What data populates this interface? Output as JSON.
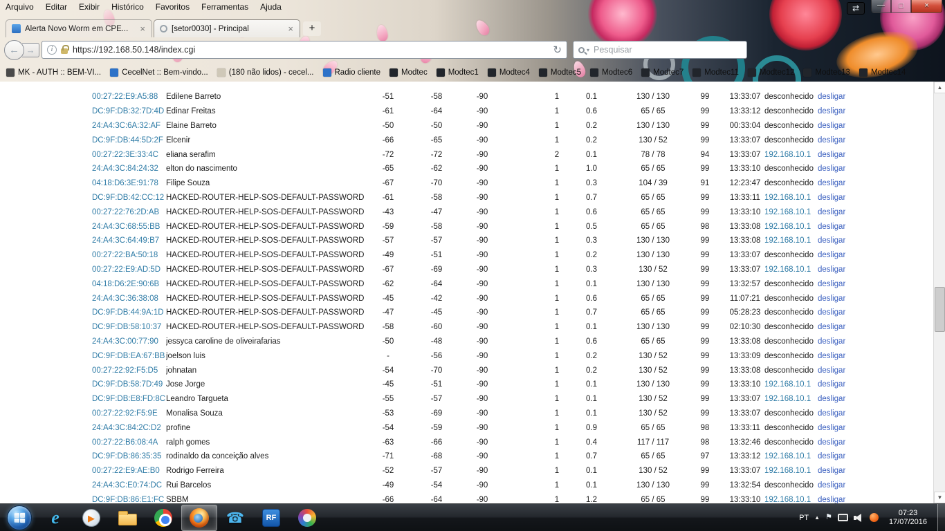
{
  "colors": {
    "mac_link": "#2e7ba6",
    "action_link": "#3a5fbf"
  },
  "browser": {
    "menu": [
      "Arquivo",
      "Editar",
      "Exibir",
      "Histórico",
      "Favoritos",
      "Ferramentas",
      "Ajuda"
    ],
    "window_controls": {
      "fullscreen": "⇄",
      "minimize": "—",
      "maximize": "□",
      "close": "×"
    },
    "tabs": [
      {
        "title": "Alerta Novo Worm em CPE...",
        "close": "×"
      },
      {
        "title": "[setor0030] - Principal",
        "close": "×"
      }
    ],
    "new_tab": "+",
    "nav": {
      "back": "←",
      "forward": "→",
      "url": "https://192.168.50.148/index.cgi",
      "reload": "↻",
      "identity": "i",
      "search_placeholder": "Pesquisar"
    },
    "bookmarks": [
      {
        "label": "MK - AUTH :: BEM-VI...",
        "icon_color": "#4a4a4a"
      },
      {
        "label": "CecelNet :: Bem-vindo...",
        "icon_color": "#2d72c8"
      },
      {
        "label": "(180 não lidos) - cecel...",
        "icon_color": "#cfc8b8"
      },
      {
        "label": "Radio cliente",
        "icon_color": "#2d72c8"
      },
      {
        "label": "Modtec",
        "icon_color": "#21252b"
      },
      {
        "label": "Modtec1",
        "icon_color": "#21252b"
      },
      {
        "label": "Modtec4",
        "icon_color": "#21252b"
      },
      {
        "label": "Modtec5",
        "icon_color": "#21252b"
      },
      {
        "label": "Modtec6",
        "icon_color": "#21252b"
      },
      {
        "label": "Modtec7",
        "icon_color": "#21252b"
      },
      {
        "label": "Modtec11",
        "icon_color": "#21252b"
      },
      {
        "label": "Modtec12",
        "icon_color": "#21252b"
      },
      {
        "label": "Modtec13",
        "icon_color": "#21252b"
      },
      {
        "label": "Modtec14",
        "icon_color": "#21252b"
      }
    ]
  },
  "page": {
    "unknown_ip_label": "desconhecido",
    "rows": [
      {
        "mac": "00:27:22:E9:A5:88",
        "name": "Edilene Barreto",
        "s1": "-51",
        "s2": "-58",
        "noise": "-90",
        "n": "1",
        "rate": "0.1",
        "speed": "130 / 130",
        "ccq": "99",
        "time": "13:33:07",
        "ip": "desconhecido",
        "action": "desligar"
      },
      {
        "mac": "DC:9F:DB:32:7D:4D",
        "name": "Edinar Freitas",
        "s1": "-61",
        "s2": "-64",
        "noise": "-90",
        "n": "1",
        "rate": "0.6",
        "speed": "65 / 65",
        "ccq": "99",
        "time": "13:33:12",
        "ip": "desconhecido",
        "action": "desligar"
      },
      {
        "mac": "24:A4:3C:6A:32:AF",
        "name": "Elaine Barreto",
        "s1": "-50",
        "s2": "-50",
        "noise": "-90",
        "n": "1",
        "rate": "0.2",
        "speed": "130 / 130",
        "ccq": "99",
        "time": "00:33:04",
        "ip": "desconhecido",
        "action": "desligar"
      },
      {
        "mac": "DC:9F:DB:44:5D:2F",
        "name": "Elcenir",
        "s1": "-66",
        "s2": "-65",
        "noise": "-90",
        "n": "1",
        "rate": "0.2",
        "speed": "130 / 52",
        "ccq": "99",
        "time": "13:33:07",
        "ip": "desconhecido",
        "action": "desligar"
      },
      {
        "mac": "00:27:22:3E:33:4C",
        "name": "eliana serafim",
        "s1": "-72",
        "s2": "-72",
        "noise": "-90",
        "n": "2",
        "rate": "0.1",
        "speed": "78 / 78",
        "ccq": "94",
        "time": "13:33:07",
        "ip": "192.168.10.1",
        "action": "desligar"
      },
      {
        "mac": "24:A4:3C:84:24:32",
        "name": "elton do nascimento",
        "s1": "-65",
        "s2": "-62",
        "noise": "-90",
        "n": "1",
        "rate": "1.0",
        "speed": "65 / 65",
        "ccq": "99",
        "time": "13:33:10",
        "ip": "desconhecido",
        "action": "desligar"
      },
      {
        "mac": "04:18:D6:3E:91:78",
        "name": "Filipe Souza",
        "s1": "-67",
        "s2": "-70",
        "noise": "-90",
        "n": "1",
        "rate": "0.3",
        "speed": "104 / 39",
        "ccq": "91",
        "time": "12:23:47",
        "ip": "desconhecido",
        "action": "desligar"
      },
      {
        "mac": "DC:9F:DB:42:CC:12",
        "name": "HACKED-ROUTER-HELP-SOS-DEFAULT-PASSWORD",
        "s1": "-61",
        "s2": "-58",
        "noise": "-90",
        "n": "1",
        "rate": "0.7",
        "speed": "65 / 65",
        "ccq": "99",
        "time": "13:33:11",
        "ip": "192.168.10.1",
        "action": "desligar"
      },
      {
        "mac": "00:27:22:76:2D:AB",
        "name": "HACKED-ROUTER-HELP-SOS-DEFAULT-PASSWORD",
        "s1": "-43",
        "s2": "-47",
        "noise": "-90",
        "n": "1",
        "rate": "0.6",
        "speed": "65 / 65",
        "ccq": "99",
        "time": "13:33:10",
        "ip": "192.168.10.1",
        "action": "desligar"
      },
      {
        "mac": "24:A4:3C:68:55:BB",
        "name": "HACKED-ROUTER-HELP-SOS-DEFAULT-PASSWORD",
        "s1": "-59",
        "s2": "-58",
        "noise": "-90",
        "n": "1",
        "rate": "0.5",
        "speed": "65 / 65",
        "ccq": "98",
        "time": "13:33:08",
        "ip": "192.168.10.1",
        "action": "desligar"
      },
      {
        "mac": "24:A4:3C:64:49:B7",
        "name": "HACKED-ROUTER-HELP-SOS-DEFAULT-PASSWORD",
        "s1": "-57",
        "s2": "-57",
        "noise": "-90",
        "n": "1",
        "rate": "0.3",
        "speed": "130 / 130",
        "ccq": "99",
        "time": "13:33:08",
        "ip": "192.168.10.1",
        "action": "desligar"
      },
      {
        "mac": "00:27:22:BA:50:18",
        "name": "HACKED-ROUTER-HELP-SOS-DEFAULT-PASSWORD",
        "s1": "-49",
        "s2": "-51",
        "noise": "-90",
        "n": "1",
        "rate": "0.2",
        "speed": "130 / 130",
        "ccq": "99",
        "time": "13:33:07",
        "ip": "desconhecido",
        "action": "desligar"
      },
      {
        "mac": "00:27:22:E9:AD:5D",
        "name": "HACKED-ROUTER-HELP-SOS-DEFAULT-PASSWORD",
        "s1": "-67",
        "s2": "-69",
        "noise": "-90",
        "n": "1",
        "rate": "0.3",
        "speed": "130 / 52",
        "ccq": "99",
        "time": "13:33:07",
        "ip": "192.168.10.1",
        "action": "desligar"
      },
      {
        "mac": "04:18:D6:2E:90:6B",
        "name": "HACKED-ROUTER-HELP-SOS-DEFAULT-PASSWORD",
        "s1": "-62",
        "s2": "-64",
        "noise": "-90",
        "n": "1",
        "rate": "0.1",
        "speed": "130 / 130",
        "ccq": "99",
        "time": "13:32:57",
        "ip": "desconhecido",
        "action": "desligar"
      },
      {
        "mac": "24:A4:3C:36:38:08",
        "name": "HACKED-ROUTER-HELP-SOS-DEFAULT-PASSWORD",
        "s1": "-45",
        "s2": "-42",
        "noise": "-90",
        "n": "1",
        "rate": "0.6",
        "speed": "65 / 65",
        "ccq": "99",
        "time": "11:07:21",
        "ip": "desconhecido",
        "action": "desligar"
      },
      {
        "mac": "DC:9F:DB:44:9A:1D",
        "name": "HACKED-ROUTER-HELP-SOS-DEFAULT-PASSWORD",
        "s1": "-47",
        "s2": "-45",
        "noise": "-90",
        "n": "1",
        "rate": "0.7",
        "speed": "65 / 65",
        "ccq": "99",
        "time": "05:28:23",
        "ip": "desconhecido",
        "action": "desligar"
      },
      {
        "mac": "DC:9F:DB:58:10:37",
        "name": "HACKED-ROUTER-HELP-SOS-DEFAULT-PASSWORD",
        "s1": "-58",
        "s2": "-60",
        "noise": "-90",
        "n": "1",
        "rate": "0.1",
        "speed": "130 / 130",
        "ccq": "99",
        "time": "02:10:30",
        "ip": "desconhecido",
        "action": "desligar"
      },
      {
        "mac": "24:A4:3C:00:77:90",
        "name": "jessyca caroline de oliveirafarias",
        "s1": "-50",
        "s2": "-48",
        "noise": "-90",
        "n": "1",
        "rate": "0.6",
        "speed": "65 / 65",
        "ccq": "99",
        "time": "13:33:08",
        "ip": "desconhecido",
        "action": "desligar"
      },
      {
        "mac": "DC:9F:DB:EA:67:BB",
        "name": "joelson luis",
        "s1": "-",
        "s2": "-56",
        "noise": "-90",
        "n": "1",
        "rate": "0.2",
        "speed": "130 / 52",
        "ccq": "99",
        "time": "13:33:09",
        "ip": "desconhecido",
        "action": "desligar"
      },
      {
        "mac": "00:27:22:92:F5:D5",
        "name": "johnatan",
        "s1": "-54",
        "s2": "-70",
        "noise": "-90",
        "n": "1",
        "rate": "0.2",
        "speed": "130 / 52",
        "ccq": "99",
        "time": "13:33:08",
        "ip": "desconhecido",
        "action": "desligar"
      },
      {
        "mac": "DC:9F:DB:58:7D:49",
        "name": "Jose Jorge",
        "s1": "-45",
        "s2": "-51",
        "noise": "-90",
        "n": "1",
        "rate": "0.1",
        "speed": "130 / 130",
        "ccq": "99",
        "time": "13:33:10",
        "ip": "192.168.10.1",
        "action": "desligar"
      },
      {
        "mac": "DC:9F:DB:E8:FD:8C",
        "name": "Leandro Targueta",
        "s1": "-55",
        "s2": "-57",
        "noise": "-90",
        "n": "1",
        "rate": "0.1",
        "speed": "130 / 52",
        "ccq": "99",
        "time": "13:33:07",
        "ip": "192.168.10.1",
        "action": "desligar"
      },
      {
        "mac": "00:27:22:92:F5:9E",
        "name": "Monalisa Souza",
        "s1": "-53",
        "s2": "-69",
        "noise": "-90",
        "n": "1",
        "rate": "0.1",
        "speed": "130 / 52",
        "ccq": "99",
        "time": "13:33:07",
        "ip": "desconhecido",
        "action": "desligar"
      },
      {
        "mac": "24:A4:3C:84:2C:D2",
        "name": "profine",
        "s1": "-54",
        "s2": "-59",
        "noise": "-90",
        "n": "1",
        "rate": "0.9",
        "speed": "65 / 65",
        "ccq": "98",
        "time": "13:33:11",
        "ip": "desconhecido",
        "action": "desligar"
      },
      {
        "mac": "00:27:22:B6:08:4A",
        "name": "ralph gomes",
        "s1": "-63",
        "s2": "-66",
        "noise": "-90",
        "n": "1",
        "rate": "0.4",
        "speed": "117 / 117",
        "ccq": "98",
        "time": "13:32:46",
        "ip": "desconhecido",
        "action": "desligar"
      },
      {
        "mac": "DC:9F:DB:86:35:35",
        "name": "rodinaldo da conceição alves",
        "s1": "-71",
        "s2": "-68",
        "noise": "-90",
        "n": "1",
        "rate": "0.7",
        "speed": "65 / 65",
        "ccq": "97",
        "time": "13:33:12",
        "ip": "192.168.10.1",
        "action": "desligar"
      },
      {
        "mac": "00:27:22:E9:AE:B0",
        "name": "Rodrigo Ferreira",
        "s1": "-52",
        "s2": "-57",
        "noise": "-90",
        "n": "1",
        "rate": "0.1",
        "speed": "130 / 52",
        "ccq": "99",
        "time": "13:33:07",
        "ip": "192.168.10.1",
        "action": "desligar"
      },
      {
        "mac": "24:A4:3C:E0:74:DC",
        "name": "Rui Barcelos",
        "s1": "-49",
        "s2": "-54",
        "noise": "-90",
        "n": "1",
        "rate": "0.1",
        "speed": "130 / 130",
        "ccq": "99",
        "time": "13:32:54",
        "ip": "desconhecido",
        "action": "desligar"
      },
      {
        "mac": "DC:9F:DB:86:E1:FC",
        "name": "SBBM",
        "s1": "-66",
        "s2": "-64",
        "noise": "-90",
        "n": "1",
        "rate": "1.2",
        "speed": "65 / 65",
        "ccq": "99",
        "time": "13:33:10",
        "ip": "192.168.10.1",
        "action": "desligar"
      }
    ]
  },
  "taskbar": {
    "glyphs": {
      "ie": "e",
      "media_play": "▶",
      "rf": "RF",
      "phone": "☎",
      "tray_flag": "⚑"
    },
    "tray": {
      "lang": "PT",
      "hidden_icons": "▲",
      "time": "07:23",
      "date": "17/07/2016"
    }
  },
  "ui": {
    "scroll_up": "▲",
    "scroll_down": "▼"
  }
}
